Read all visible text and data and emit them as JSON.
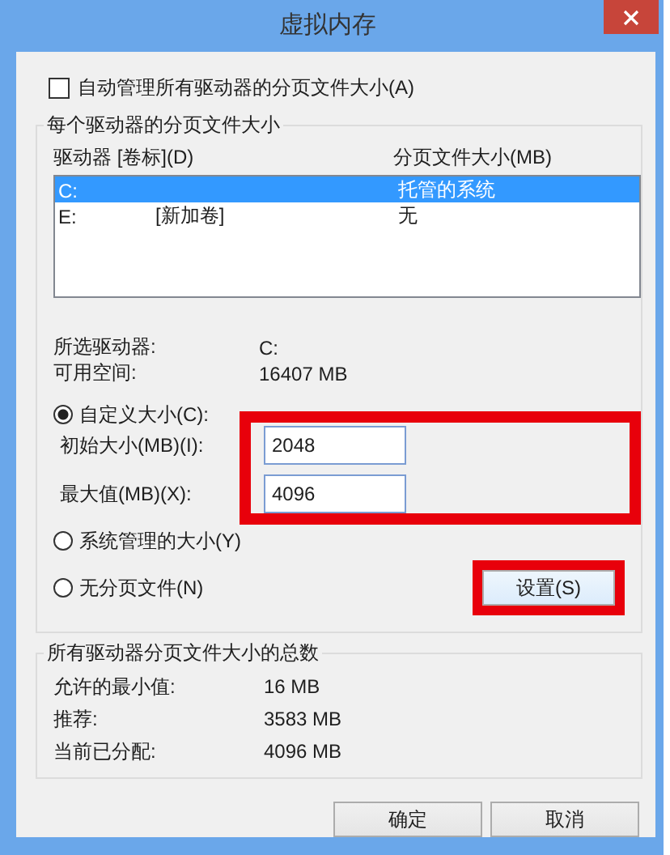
{
  "window": {
    "title": "虚拟内存"
  },
  "auto_manage": {
    "label": "自动管理所有驱动器的分页文件大小(A)",
    "checked": false
  },
  "per_drive": {
    "title": "每个驱动器的分页文件大小",
    "columns": [
      "驱动器 [卷标](D)",
      "分页文件大小(MB)"
    ],
    "rows": [
      {
        "drive": "C:",
        "paging_size": "托管的系统",
        "selected": true
      },
      {
        "drive": "E:",
        "volume": "[新加卷]",
        "paging_size": "无",
        "selected": false
      }
    ],
    "info": [
      {
        "label": "所选驱动器:",
        "value": "C:"
      },
      {
        "label": "可用空间:",
        "value": "16407 MB"
      }
    ],
    "options": [
      {
        "label": "自定义大小(C):",
        "selected": true
      },
      {
        "label": "系统管理的大小(Y)",
        "selected": false
      },
      {
        "label": "无分页文件(N)",
        "selected": false
      }
    ],
    "fields": [
      {
        "label": "初始大小(MB)(I):",
        "value": "2048"
      },
      {
        "label": "最大值(MB)(X):",
        "value": "4096"
      }
    ],
    "fields_highlighted": true,
    "set_button": {
      "label": "设置(S)",
      "highlighted": true
    }
  },
  "totals": {
    "title": "所有驱动器分页文件大小的总数",
    "rows": [
      {
        "label": "允许的最小值:",
        "value": "16 MB"
      },
      {
        "label": "推荐:",
        "value": "3583 MB"
      },
      {
        "label": "当前已分配:",
        "value": "4096 MB"
      }
    ]
  },
  "buttons": [
    "确定",
    "取消"
  ]
}
